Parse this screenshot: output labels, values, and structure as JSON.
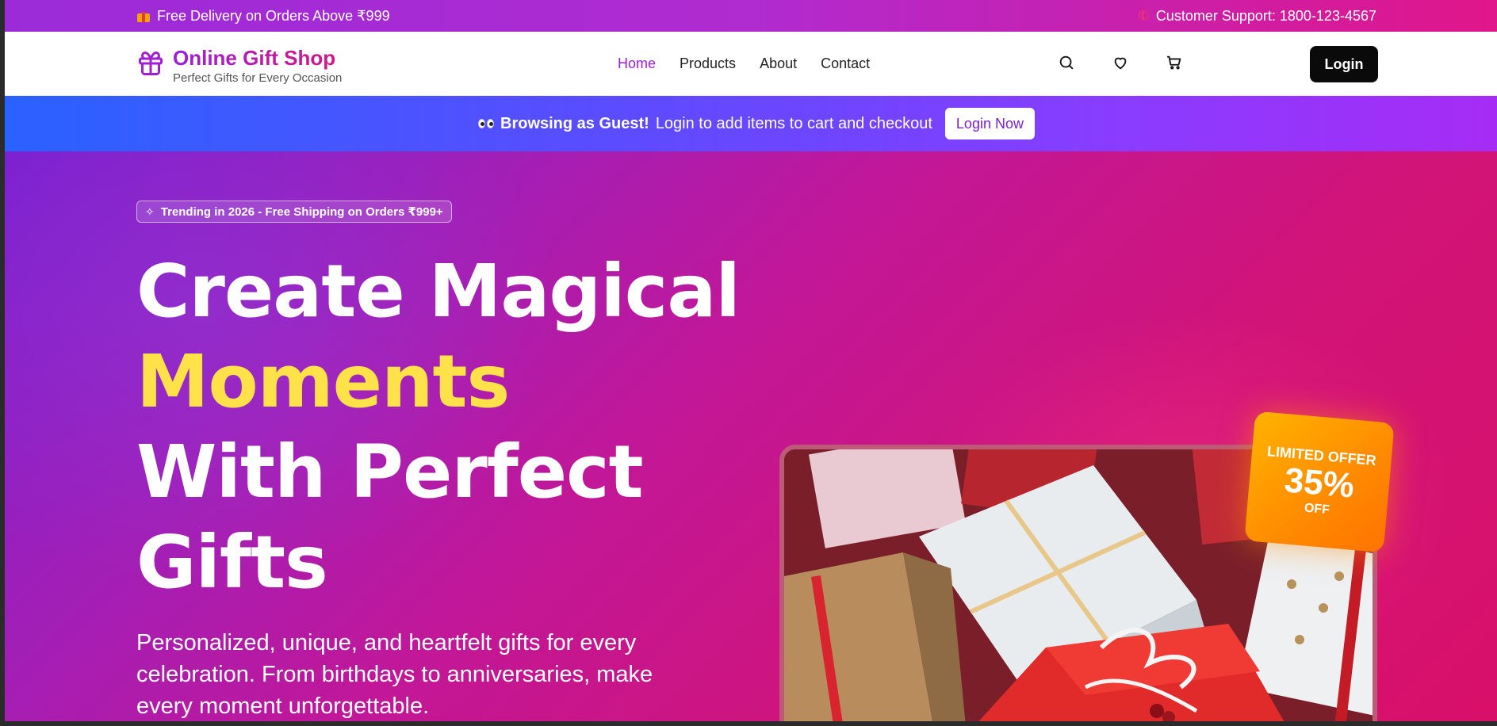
{
  "topbar": {
    "promo_text": "Free Delivery on Orders Above ₹999",
    "support_text": "Customer Support: 1800-123-4567"
  },
  "header": {
    "brand_title": "Online Gift Shop",
    "brand_subtitle": "Perfect Gifts for Every Occasion",
    "nav": [
      {
        "label": "Home",
        "active": true
      },
      {
        "label": "Products",
        "active": false
      },
      {
        "label": "About",
        "active": false
      },
      {
        "label": "Contact",
        "active": false
      }
    ],
    "icons": [
      "search-icon",
      "heart-icon",
      "cart-icon"
    ],
    "login_label": "Login"
  },
  "guest_banner": {
    "bold_text": "Browsing as Guest!",
    "text": "Login to add items to cart and checkout",
    "button_label": "Login Now"
  },
  "hero": {
    "trend_pill": "Trending in 2026 - Free Shipping on Orders ₹999+",
    "headline_line1": "Create Magical",
    "headline_highlight": "Moments",
    "headline_line3": "With Perfect",
    "headline_line4": "Gifts",
    "subtext": "Personalized, unique, and heartfelt gifts for every celebration. From birthdays to anniversaries, make every moment unforgettable.",
    "offer": {
      "label": "LIMITED OFFER",
      "value": "35%",
      "suffix": "OFF"
    }
  },
  "colors": {
    "brand_purple": "#9b1fd8",
    "brand_pink": "#d4187e",
    "highlight_yellow": "#ffe14a",
    "offer_orange": "#ff8a00"
  }
}
